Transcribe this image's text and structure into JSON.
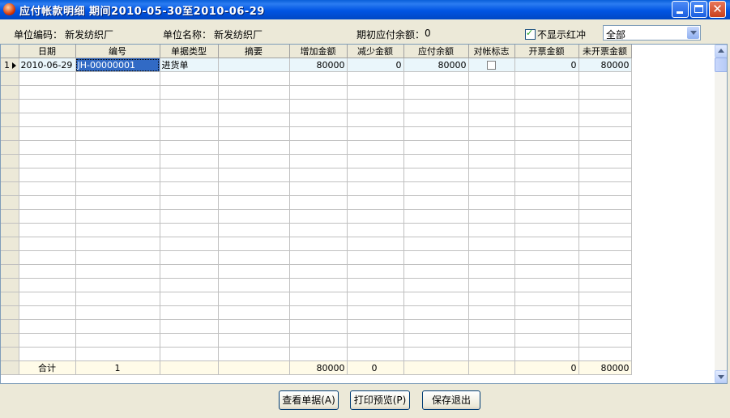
{
  "window": {
    "title": "应付帐款明细  期间2010-05-30至2010-06-29",
    "close_glyph": "✕"
  },
  "info": {
    "unit_code_label": "单位编码：",
    "unit_code": "新发纺织厂",
    "unit_name_label": "单位名称：",
    "unit_name": "新发纺织厂",
    "opening_label": "期初应付余额：",
    "opening_value": "0",
    "hide_red_label": "不显示红冲",
    "hide_red_checked": true,
    "filter_selected": "全部"
  },
  "grid": {
    "columns": [
      "日期",
      "编号",
      "单据类型",
      "摘要",
      "增加金额",
      "减少金额",
      "应付余额",
      "对帐标志",
      "开票金额",
      "未开票金额"
    ],
    "rows": [
      {
        "index": "1",
        "date": "2010-06-29",
        "number": "JH-00000001",
        "doc_type": "进货单",
        "summary": "",
        "increase": "80000",
        "decrease": "0",
        "balance": "80000",
        "reconciled": false,
        "invoiced": "0",
        "uninvoiced": "80000"
      }
    ],
    "totals": {
      "label": "合计",
      "count": "1",
      "increase": "80000",
      "decrease": "0",
      "invoiced": "0",
      "uninvoiced": "80000"
    }
  },
  "buttons": {
    "view_doc": "查看单据(A)",
    "print_preview": "打印预览(P)",
    "save_exit": "保存退出"
  }
}
